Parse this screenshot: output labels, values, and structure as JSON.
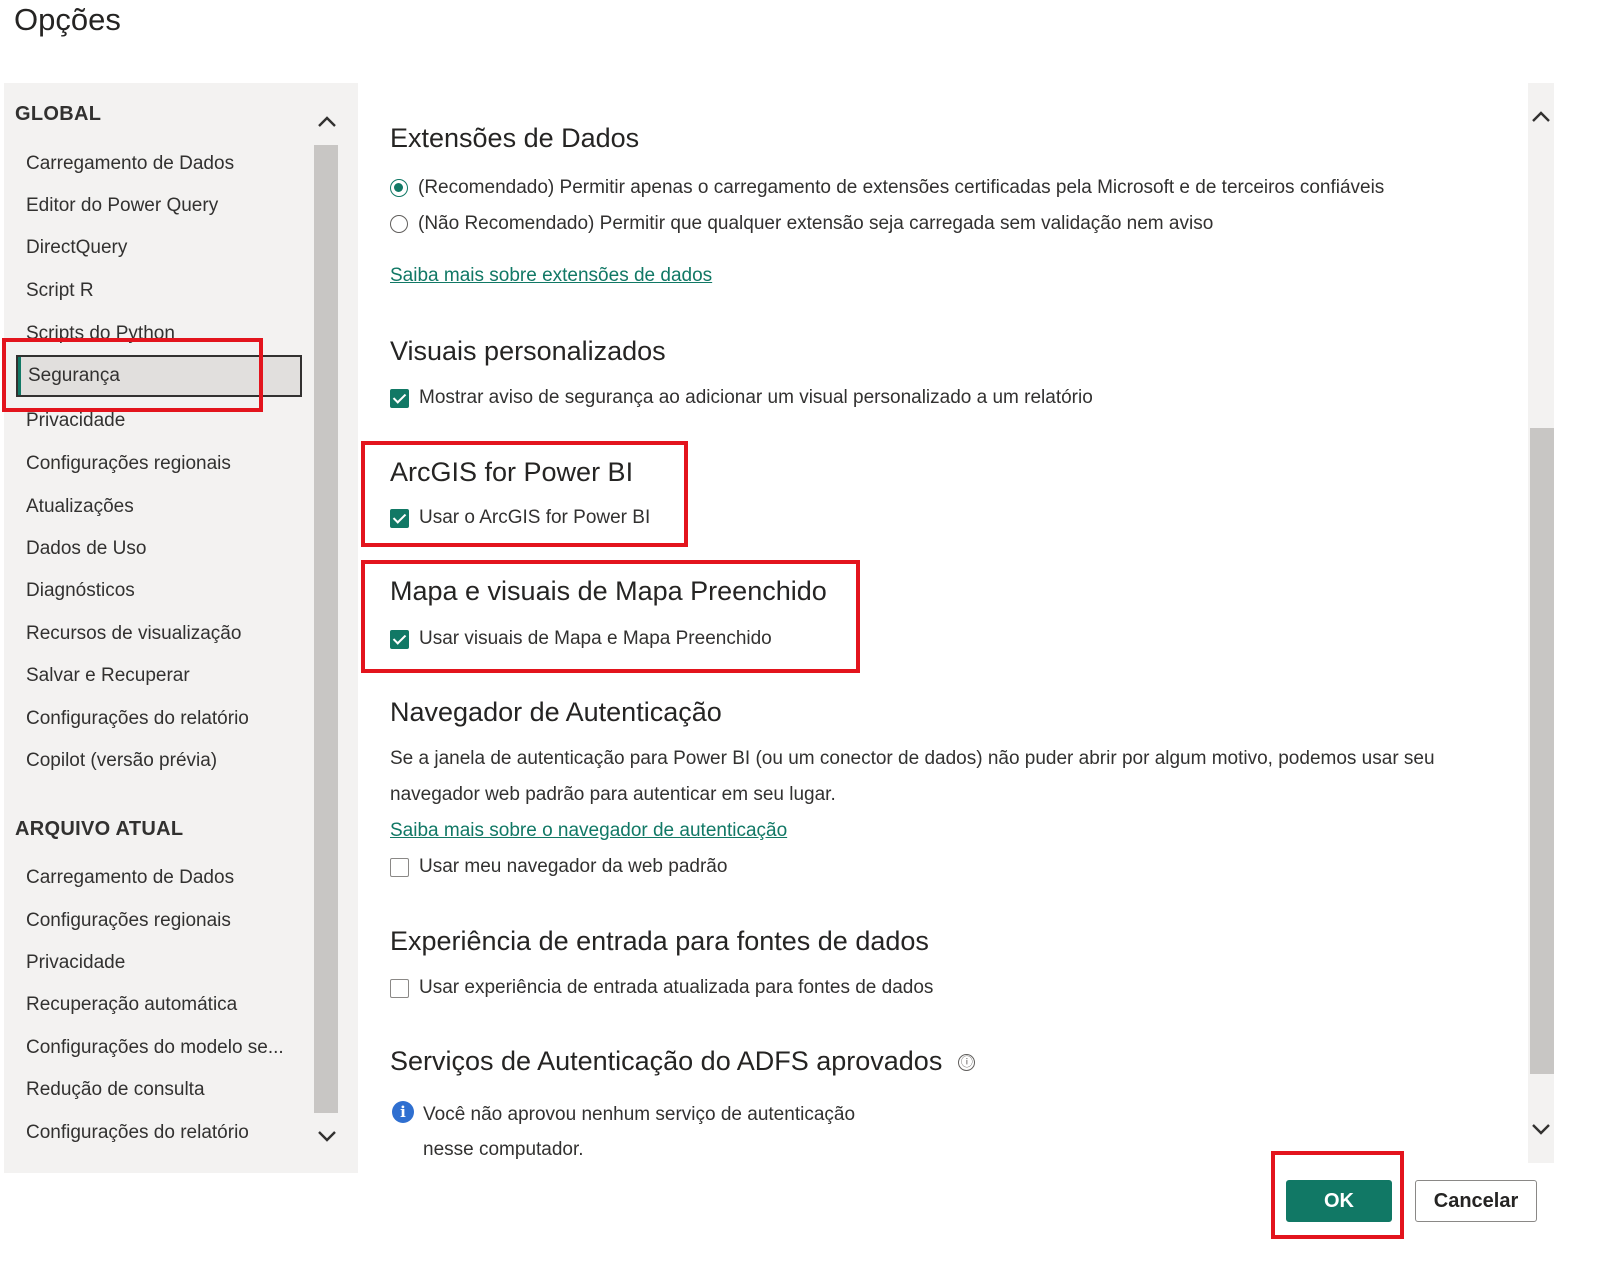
{
  "window": {
    "title": "Opções"
  },
  "nav": {
    "global_header": "GLOBAL",
    "global_items": [
      "Carregamento de Dados",
      "Editor do Power Query",
      "DirectQuery",
      "Script R",
      "Scripts do Python",
      "Segurança",
      "Privacidade",
      "Configurações regionais",
      "Atualizações",
      "Dados de Uso",
      "Diagnósticos",
      "Recursos de visualização",
      "Salvar e Recuperar",
      "Configurações do relatório",
      "Copilot (versão prévia)"
    ],
    "selected": "Segurança",
    "file_header": "ARQUIVO ATUAL",
    "file_items": [
      "Carregamento de Dados",
      "Configurações regionais",
      "Privacidade",
      "Recuperação automática",
      "Configurações do modelo se...",
      "Redução de consulta",
      "Configurações do relatório"
    ]
  },
  "sections": {
    "data_extensions": {
      "title": "Extensões de Dados",
      "option_recommended": "(Recomendado) Permitir apenas o carregamento de extensões certificadas pela Microsoft e de terceiros confiáveis",
      "option_not_recommended": "(Não Recomendado) Permitir que qualquer extensão seja carregada sem validação nem aviso",
      "selected_option": "recommended",
      "link": "Saiba mais sobre extensões de dados"
    },
    "custom_visuals": {
      "title": "Visuais personalizados",
      "checkbox": "Mostrar aviso de segurança ao adicionar um visual personalizado a um relatório",
      "checked": true
    },
    "arcgis": {
      "title": "ArcGIS for Power BI",
      "checkbox": "Usar o ArcGIS for Power BI",
      "checked": true
    },
    "map_visuals": {
      "title": "Mapa e visuais de Mapa Preenchido",
      "checkbox": "Usar visuais de Mapa e Mapa Preenchido",
      "checked": true
    },
    "auth_browser": {
      "title": "Navegador de Autenticação",
      "description": "Se a janela de autenticação para Power BI (ou um conector de dados) não puder abrir por algum motivo, podemos usar seu navegador web padrão para autenticar em seu lugar.",
      "link": "Saiba mais sobre o navegador de autenticação",
      "checkbox": "Usar meu navegador da web padrão",
      "checked": false
    },
    "data_source_input": {
      "title": "Experiência de entrada para fontes de dados",
      "checkbox": "Usar experiência de entrada atualizada para fontes de dados",
      "checked": false
    },
    "adfs": {
      "title": "Serviços de Autenticação do ADFS aprovados",
      "info_line1": "Você não aprovou nenhum serviço de autenticação",
      "info_line2": "nesse computador."
    }
  },
  "buttons": {
    "ok": "OK",
    "cancel": "Cancelar"
  },
  "colors": {
    "accent": "#117865",
    "highlight": "#e3141d",
    "info": "#2f6fd0"
  },
  "icons": {
    "info_small": "ⓘ",
    "info_blue": "i",
    "up": "⌃",
    "down": "⌄"
  }
}
